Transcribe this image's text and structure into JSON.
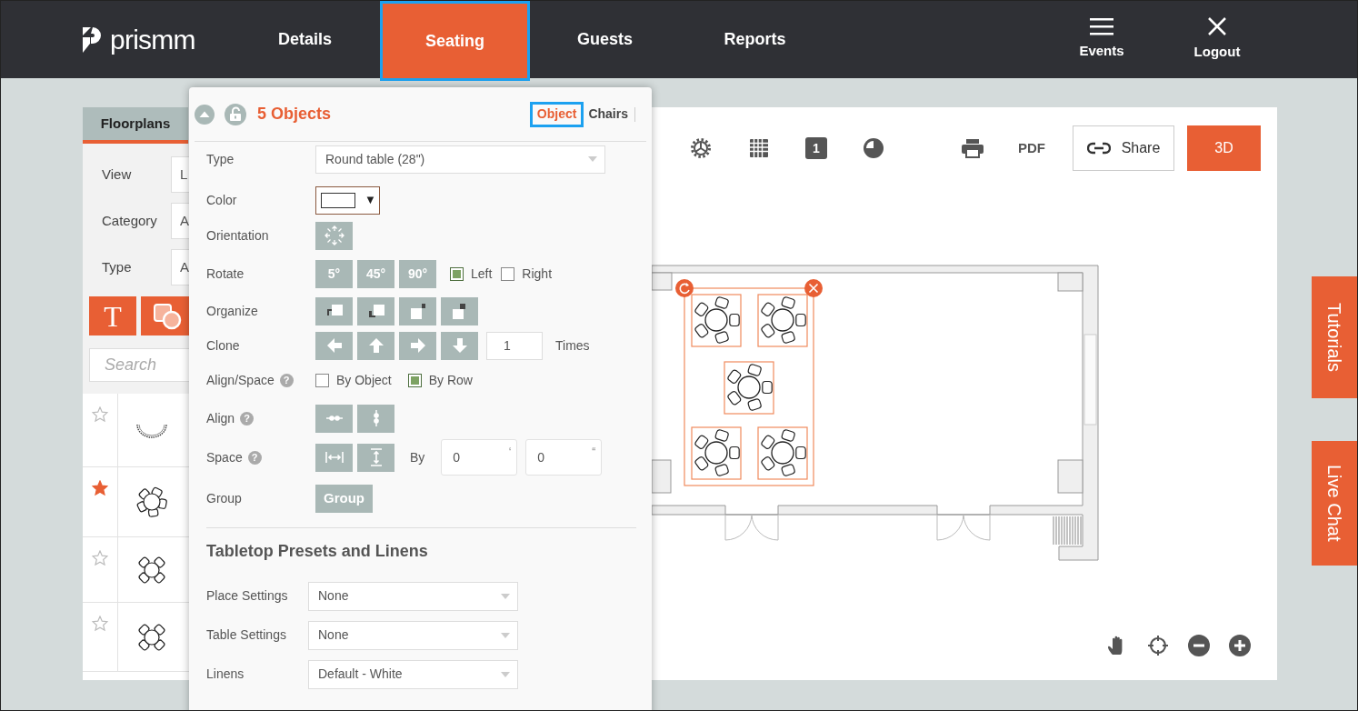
{
  "header": {
    "logo": "prismm",
    "nav": [
      {
        "label": "Details",
        "selected": false
      },
      {
        "label": "Seating",
        "selected": true
      },
      {
        "label": "Guests",
        "selected": false
      },
      {
        "label": "Reports",
        "selected": false
      }
    ],
    "actions": [
      {
        "kind": "menu",
        "label": "Events"
      },
      {
        "kind": "close",
        "label": "Logout"
      }
    ]
  },
  "sidebar": {
    "tab": "Floorplans",
    "filters": [
      {
        "label": "View",
        "value": "L"
      },
      {
        "label": "Category",
        "value": "A"
      },
      {
        "label": "Type",
        "value": "A"
      }
    ],
    "text_tool": "T",
    "search": {
      "placeholder": "Search"
    },
    "items": [
      {
        "kind": "half-round",
        "starred": false
      },
      {
        "kind": "round-5",
        "starred": true
      },
      {
        "kind": "round-4",
        "starred": false
      },
      {
        "kind": "round-4",
        "starred": false
      }
    ]
  },
  "properties": {
    "title": "5 Objects",
    "tabs": [
      {
        "label": "Object",
        "selected": true
      },
      {
        "label": "Chairs",
        "selected": false
      }
    ],
    "type": {
      "label": "Type",
      "value": "Round table (28\")"
    },
    "color": {
      "label": "Color",
      "caret": "▼"
    },
    "orientation": {
      "label": "Orientation"
    },
    "rotate": {
      "label": "Rotate",
      "buttons": [
        "5°",
        "45°",
        "90°"
      ],
      "options": [
        {
          "label": "Left",
          "checked": true
        },
        {
          "label": "Right",
          "checked": false
        }
      ]
    },
    "organize": {
      "label": "Organize"
    },
    "clone": {
      "label": "Clone",
      "value": "1",
      "suffix": "Times"
    },
    "align_space": {
      "label": "Align/Space",
      "help": "?",
      "options": [
        {
          "label": "By Object",
          "checked": false
        },
        {
          "label": "By Row",
          "checked": true
        }
      ]
    },
    "align": {
      "label": "Align",
      "help": "?"
    },
    "space": {
      "label": "Space",
      "help": "?",
      "by": "By",
      "fields": [
        {
          "value": "0",
          "mark": "‘"
        },
        {
          "value": "0",
          "mark": "“"
        }
      ]
    },
    "group": {
      "label": "Group",
      "button": "Group"
    },
    "presets": {
      "heading": "Tabletop Presets and Linens",
      "fields": [
        {
          "label": "Place Settings",
          "value": "None"
        },
        {
          "label": "Table Settings",
          "value": "None"
        },
        {
          "label": "Linens",
          "value": "Default - White"
        }
      ]
    }
  },
  "canvas": {
    "toolbar": {
      "page": "1",
      "pdf": "PDF",
      "share": "Share",
      "view_3d": "3D"
    }
  },
  "side_tabs": [
    "Tutorials",
    "Live Chat"
  ]
}
